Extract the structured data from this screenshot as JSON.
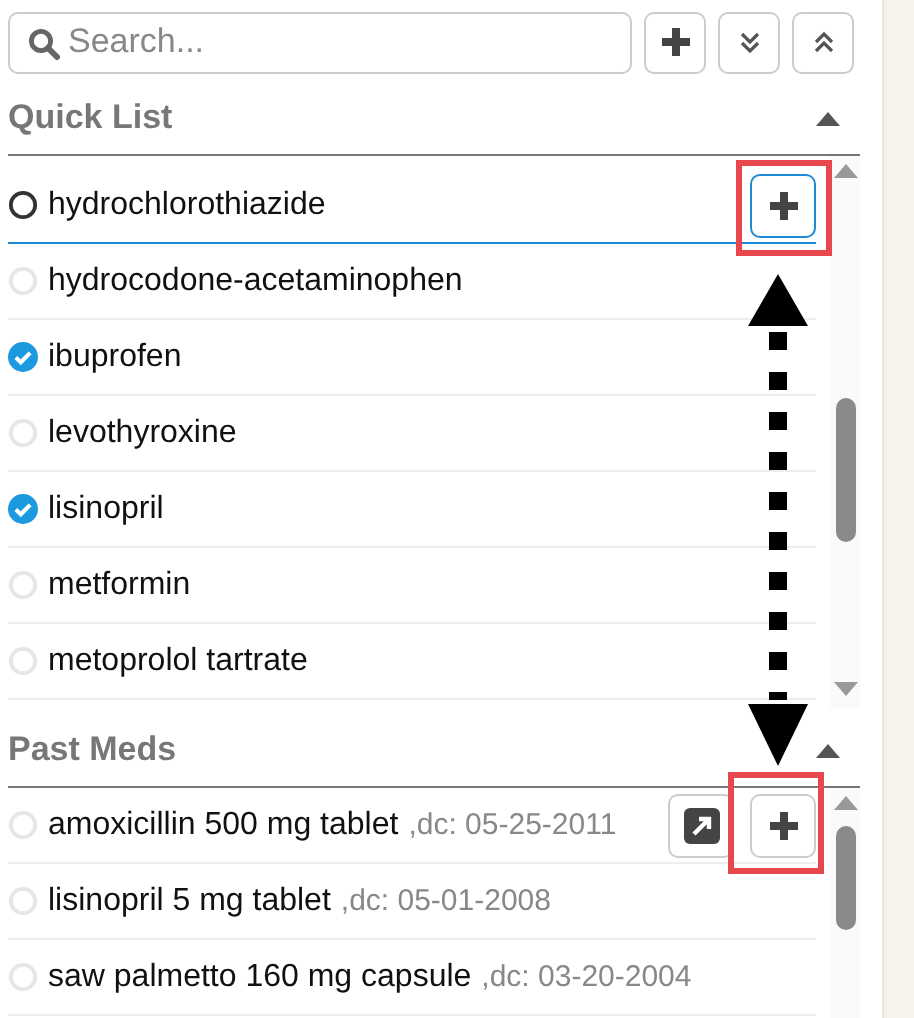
{
  "search": {
    "placeholder": "Search..."
  },
  "quick_list": {
    "title": "Quick List",
    "items": [
      {
        "name": "hydrochlorothiazide",
        "checked": false,
        "hovered": true
      },
      {
        "name": "hydrocodone-acetaminophen",
        "checked": false,
        "hovered": false
      },
      {
        "name": "ibuprofen",
        "checked": true,
        "hovered": false
      },
      {
        "name": "levothyroxine",
        "checked": false,
        "hovered": false
      },
      {
        "name": "lisinopril",
        "checked": true,
        "hovered": false
      },
      {
        "name": "metformin",
        "checked": false,
        "hovered": false
      },
      {
        "name": "metoprolol tartrate",
        "checked": false,
        "hovered": false
      }
    ]
  },
  "past_meds": {
    "title": "Past Meds",
    "items": [
      {
        "name": "amoxicillin 500 mg tablet",
        "dc": ",dc: 05-25-2011",
        "checked": false,
        "hovered": true
      },
      {
        "name": "lisinopril 5 mg tablet",
        "dc": ",dc: 05-01-2008",
        "checked": false,
        "hovered": false
      },
      {
        "name": "saw palmetto 160 mg capsule",
        "dc": ",dc: 03-20-2004",
        "checked": false,
        "hovered": false
      }
    ]
  }
}
